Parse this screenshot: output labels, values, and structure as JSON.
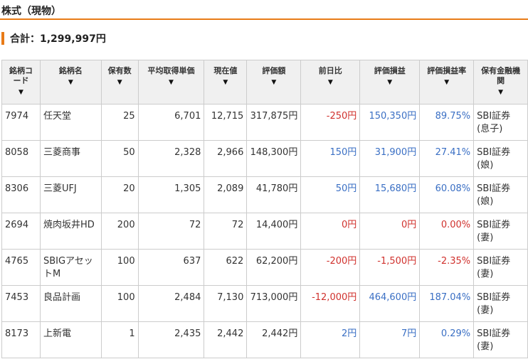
{
  "section_title": "株式（現物）",
  "total_label": "合計：1,299,997円",
  "columns": [
    {
      "label": "銘柄コード",
      "lines": [
        "銘柄コ",
        "ード"
      ]
    },
    {
      "label": "銘柄名",
      "lines": [
        "銘柄名"
      ]
    },
    {
      "label": "保有数",
      "lines": [
        "保有数"
      ]
    },
    {
      "label": "平均取得単価",
      "lines": [
        "平均取得単価"
      ]
    },
    {
      "label": "現在値",
      "lines": [
        "現在値"
      ]
    },
    {
      "label": "評価額",
      "lines": [
        "評価額"
      ]
    },
    {
      "label": "前日比",
      "lines": [
        "前日比"
      ]
    },
    {
      "label": "評価損益",
      "lines": [
        "評価損益"
      ]
    },
    {
      "label": "評価損益率",
      "lines": [
        "評価損益率"
      ]
    },
    {
      "label": "保有金融機関",
      "lines": [
        "保有金融機",
        "関"
      ]
    }
  ],
  "sort_arrow": "▼",
  "rows": [
    {
      "code": "7974",
      "name": "任天堂",
      "qty": "25",
      "avg": "6,701",
      "price": "12,715",
      "value": "317,875円",
      "day": "-250円",
      "day_sign": "neg",
      "pl": "150,350円",
      "pl_sign": "pos",
      "plr": "89.75%",
      "plr_sign": "pos",
      "inst": "SBI証券",
      "owner": "(息子)"
    },
    {
      "code": "8058",
      "name": "三菱商事",
      "qty": "50",
      "avg": "2,328",
      "price": "2,966",
      "value": "148,300円",
      "day": "150円",
      "day_sign": "pos",
      "pl": "31,900円",
      "pl_sign": "pos",
      "plr": "27.41%",
      "plr_sign": "pos",
      "inst": "SBI証券",
      "owner": "(娘)"
    },
    {
      "code": "8306",
      "name": "三菱UFJ",
      "qty": "20",
      "avg": "1,305",
      "price": "2,089",
      "value": "41,780円",
      "day": "50円",
      "day_sign": "pos",
      "pl": "15,680円",
      "pl_sign": "pos",
      "plr": "60.08%",
      "plr_sign": "pos",
      "inst": "SBI証券",
      "owner": "(娘)"
    },
    {
      "code": "2694",
      "name": "焼肉坂井HD",
      "qty": "200",
      "avg": "72",
      "price": "72",
      "value": "14,400円",
      "day": "0円",
      "day_sign": "zero",
      "pl": "0円",
      "pl_sign": "zero",
      "plr": "0.00%",
      "plr_sign": "zero",
      "inst": "SBI証券",
      "owner": "(妻)"
    },
    {
      "code": "4765",
      "name": "SBIGアセットM",
      "qty": "100",
      "avg": "637",
      "price": "622",
      "value": "62,200円",
      "day": "-200円",
      "day_sign": "neg",
      "pl": "-1,500円",
      "pl_sign": "neg",
      "plr": "-2.35%",
      "plr_sign": "neg",
      "inst": "SBI証券",
      "owner": "(妻)"
    },
    {
      "code": "7453",
      "name": "良品計画",
      "qty": "100",
      "avg": "2,484",
      "price": "7,130",
      "value": "713,000円",
      "day": "-12,000円",
      "day_sign": "neg",
      "pl": "464,600円",
      "pl_sign": "pos",
      "plr": "187.04%",
      "plr_sign": "pos",
      "inst": "SBI証券",
      "owner": "(妻)"
    },
    {
      "code": "8173",
      "name": "上新電",
      "qty": "1",
      "avg": "2,435",
      "price": "2,442",
      "value": "2,442円",
      "day": "2円",
      "day_sign": "pos",
      "pl": "7円",
      "pl_sign": "pos",
      "plr": "0.29%",
      "plr_sign": "pos",
      "inst": "SBI証券",
      "owner": "(妻)"
    }
  ]
}
